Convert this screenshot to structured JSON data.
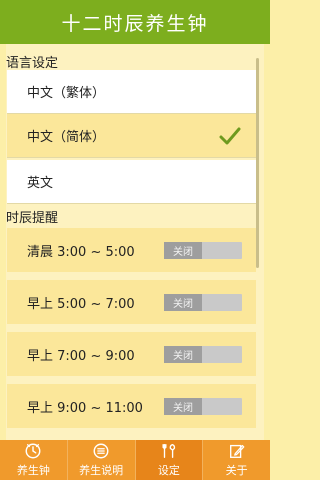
{
  "header": {
    "title": "十二时辰养生钟"
  },
  "language": {
    "section_title": "语言设定",
    "options": [
      {
        "label": "中文（繁体）",
        "selected": false
      },
      {
        "label": "中文（简体）",
        "selected": true
      },
      {
        "label": "英文",
        "selected": false
      }
    ]
  },
  "reminders": {
    "section_title": "时辰提醒",
    "items": [
      {
        "label": "清晨 3:00 ~ 5:00",
        "toggle_label": "关闭",
        "on": false
      },
      {
        "label": "早上 5:00 ~ 7:00",
        "toggle_label": "关闭",
        "on": false
      },
      {
        "label": "早上 7:00 ~ 9:00",
        "toggle_label": "关闭",
        "on": false
      },
      {
        "label": "早上 9:00 ~ 11:00",
        "toggle_label": "关闭",
        "on": false
      }
    ]
  },
  "tabbar": {
    "tabs": [
      {
        "label": "养生钟",
        "icon": "clock-icon",
        "active": false
      },
      {
        "label": "养生说明",
        "icon": "list-icon",
        "active": false
      },
      {
        "label": "设定",
        "icon": "tools-icon",
        "active": true
      },
      {
        "label": "关于",
        "icon": "edit-icon",
        "active": false
      }
    ]
  },
  "colors": {
    "header_bg": "#7DAE1E",
    "page_bg": "#FCEFA8",
    "selected_row_bg": "#FBE79A",
    "check": "#6E9A1E",
    "tabbar_bg": "#F09A2C",
    "tab_active_bg": "#E7851A"
  }
}
